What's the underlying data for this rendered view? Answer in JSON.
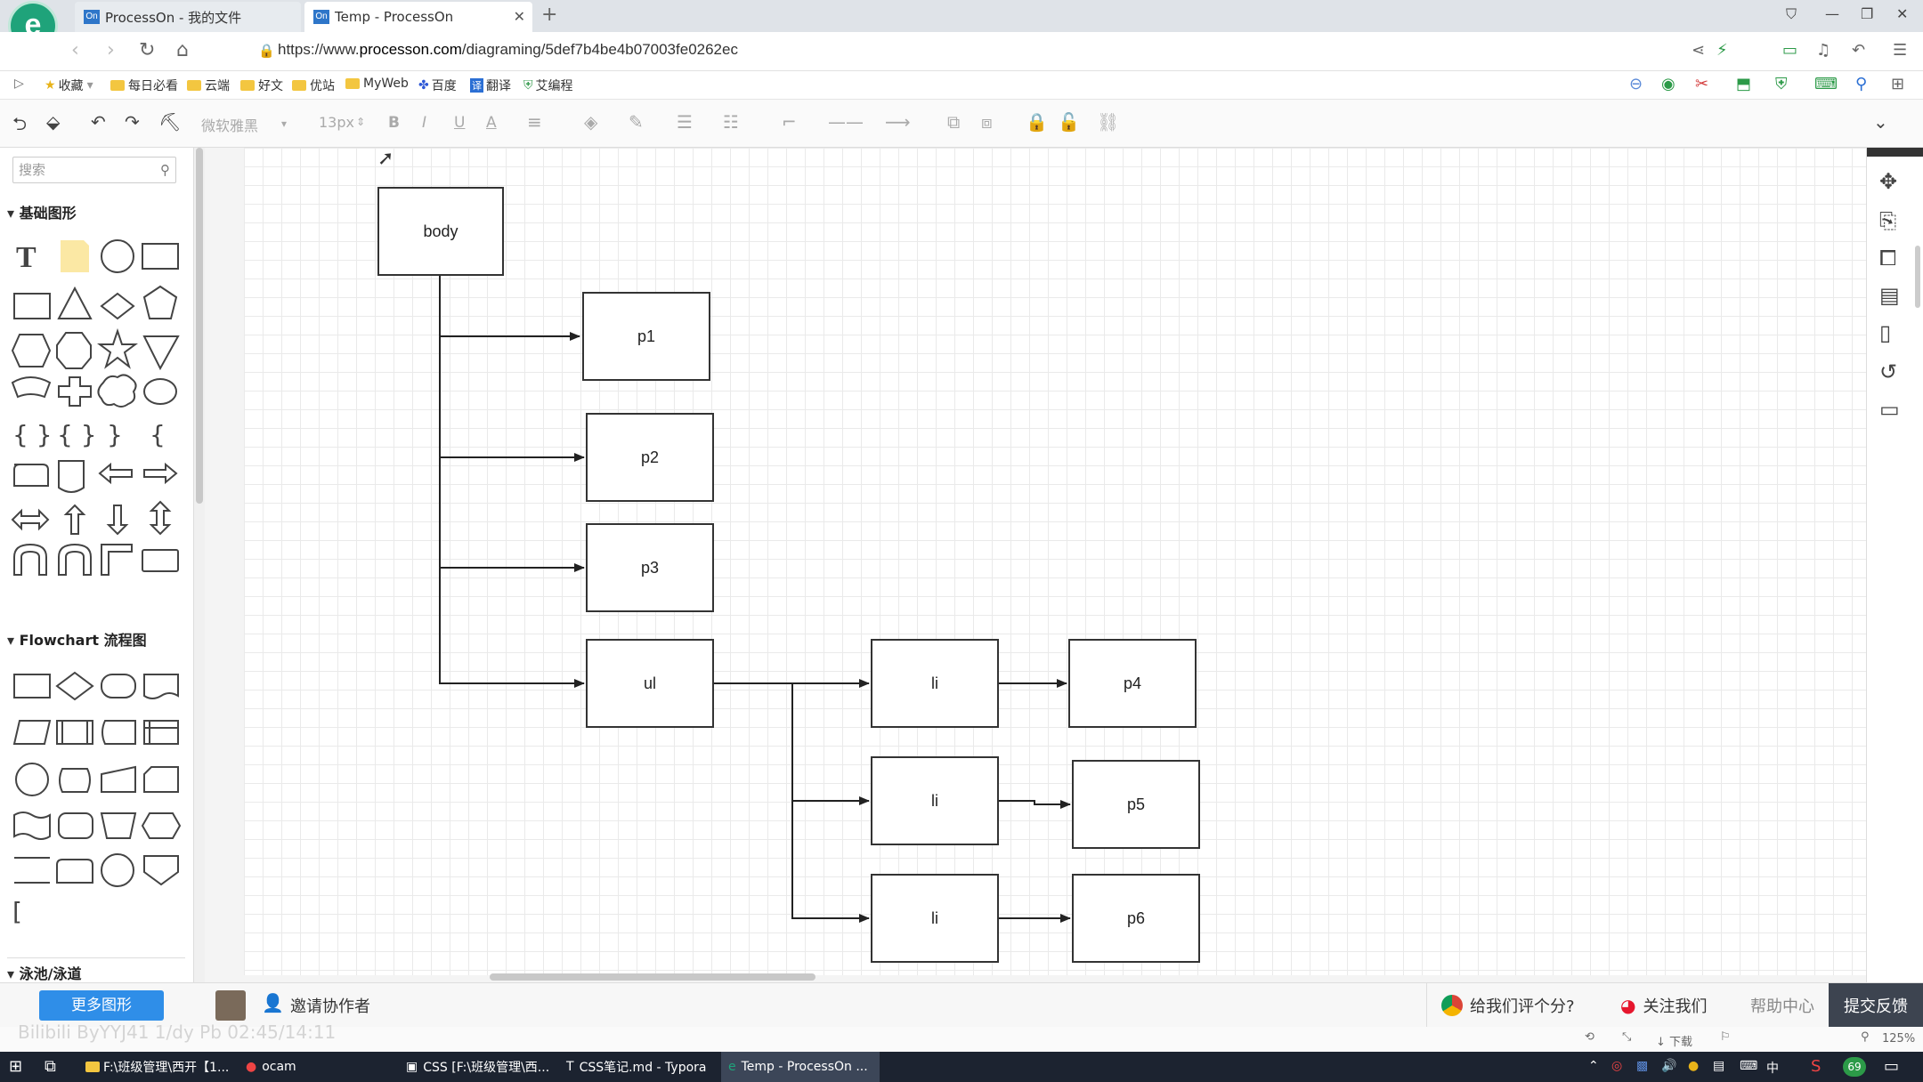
{
  "browser": {
    "tabs": [
      {
        "label": "ProcessOn - 我的文件",
        "badge": "On"
      },
      {
        "label": "Temp - ProcessOn",
        "badge": "On",
        "active": true
      }
    ],
    "url_prefix": "https://www.",
    "url_domain": "processon.com",
    "url_path": "/diagraming/5def7b4be4b07003fe0262ec"
  },
  "bookmarks": [
    "收藏",
    "每日必看",
    "云端",
    "好文",
    "优站",
    "MyWeb",
    "百度",
    "翻译",
    "艾编程"
  ],
  "toolbar": {
    "font_family": "微软雅黑",
    "font_size": "13px",
    "bold": "B",
    "italic": "I",
    "underline": "U",
    "font_color": "A"
  },
  "left_panel": {
    "search_placeholder": "搜索",
    "section_basic": "基础图形",
    "section_flowchart": "Flowchart 流程图",
    "section_swimlane": "泳池/泳道",
    "text_tool": "T"
  },
  "diagram": {
    "nodes": {
      "body": "body",
      "p1": "p1",
      "p2": "p2",
      "p3": "p3",
      "ul": "ul",
      "li1": "li",
      "li2": "li",
      "li3": "li",
      "p4": "p4",
      "p5": "p5",
      "p6": "p6"
    }
  },
  "bottom": {
    "more_shapes": "更多图形",
    "invite": "邀请协作者",
    "rate": "给我们评个分?",
    "follow": "关注我们",
    "help": "帮助中心",
    "feedback": "提交反馈"
  },
  "status": {
    "download": "下载",
    "zoom": "125%",
    "overlay": "Bilibili ByYYJ41 1/dy Pb 02:45/14:11"
  },
  "taskbar": {
    "items": [
      "F:\\班级管理\\西开【1...",
      "ocam",
      "CSS [F:\\班级管理\\西...",
      "CSS笔记.md - Typora",
      "Temp - ProcessOn ..."
    ],
    "tray_badge": "69"
  },
  "colors": {
    "accent": "#2f8ee8",
    "browser_logo": "#1fa37a",
    "node_border": "#333333"
  }
}
